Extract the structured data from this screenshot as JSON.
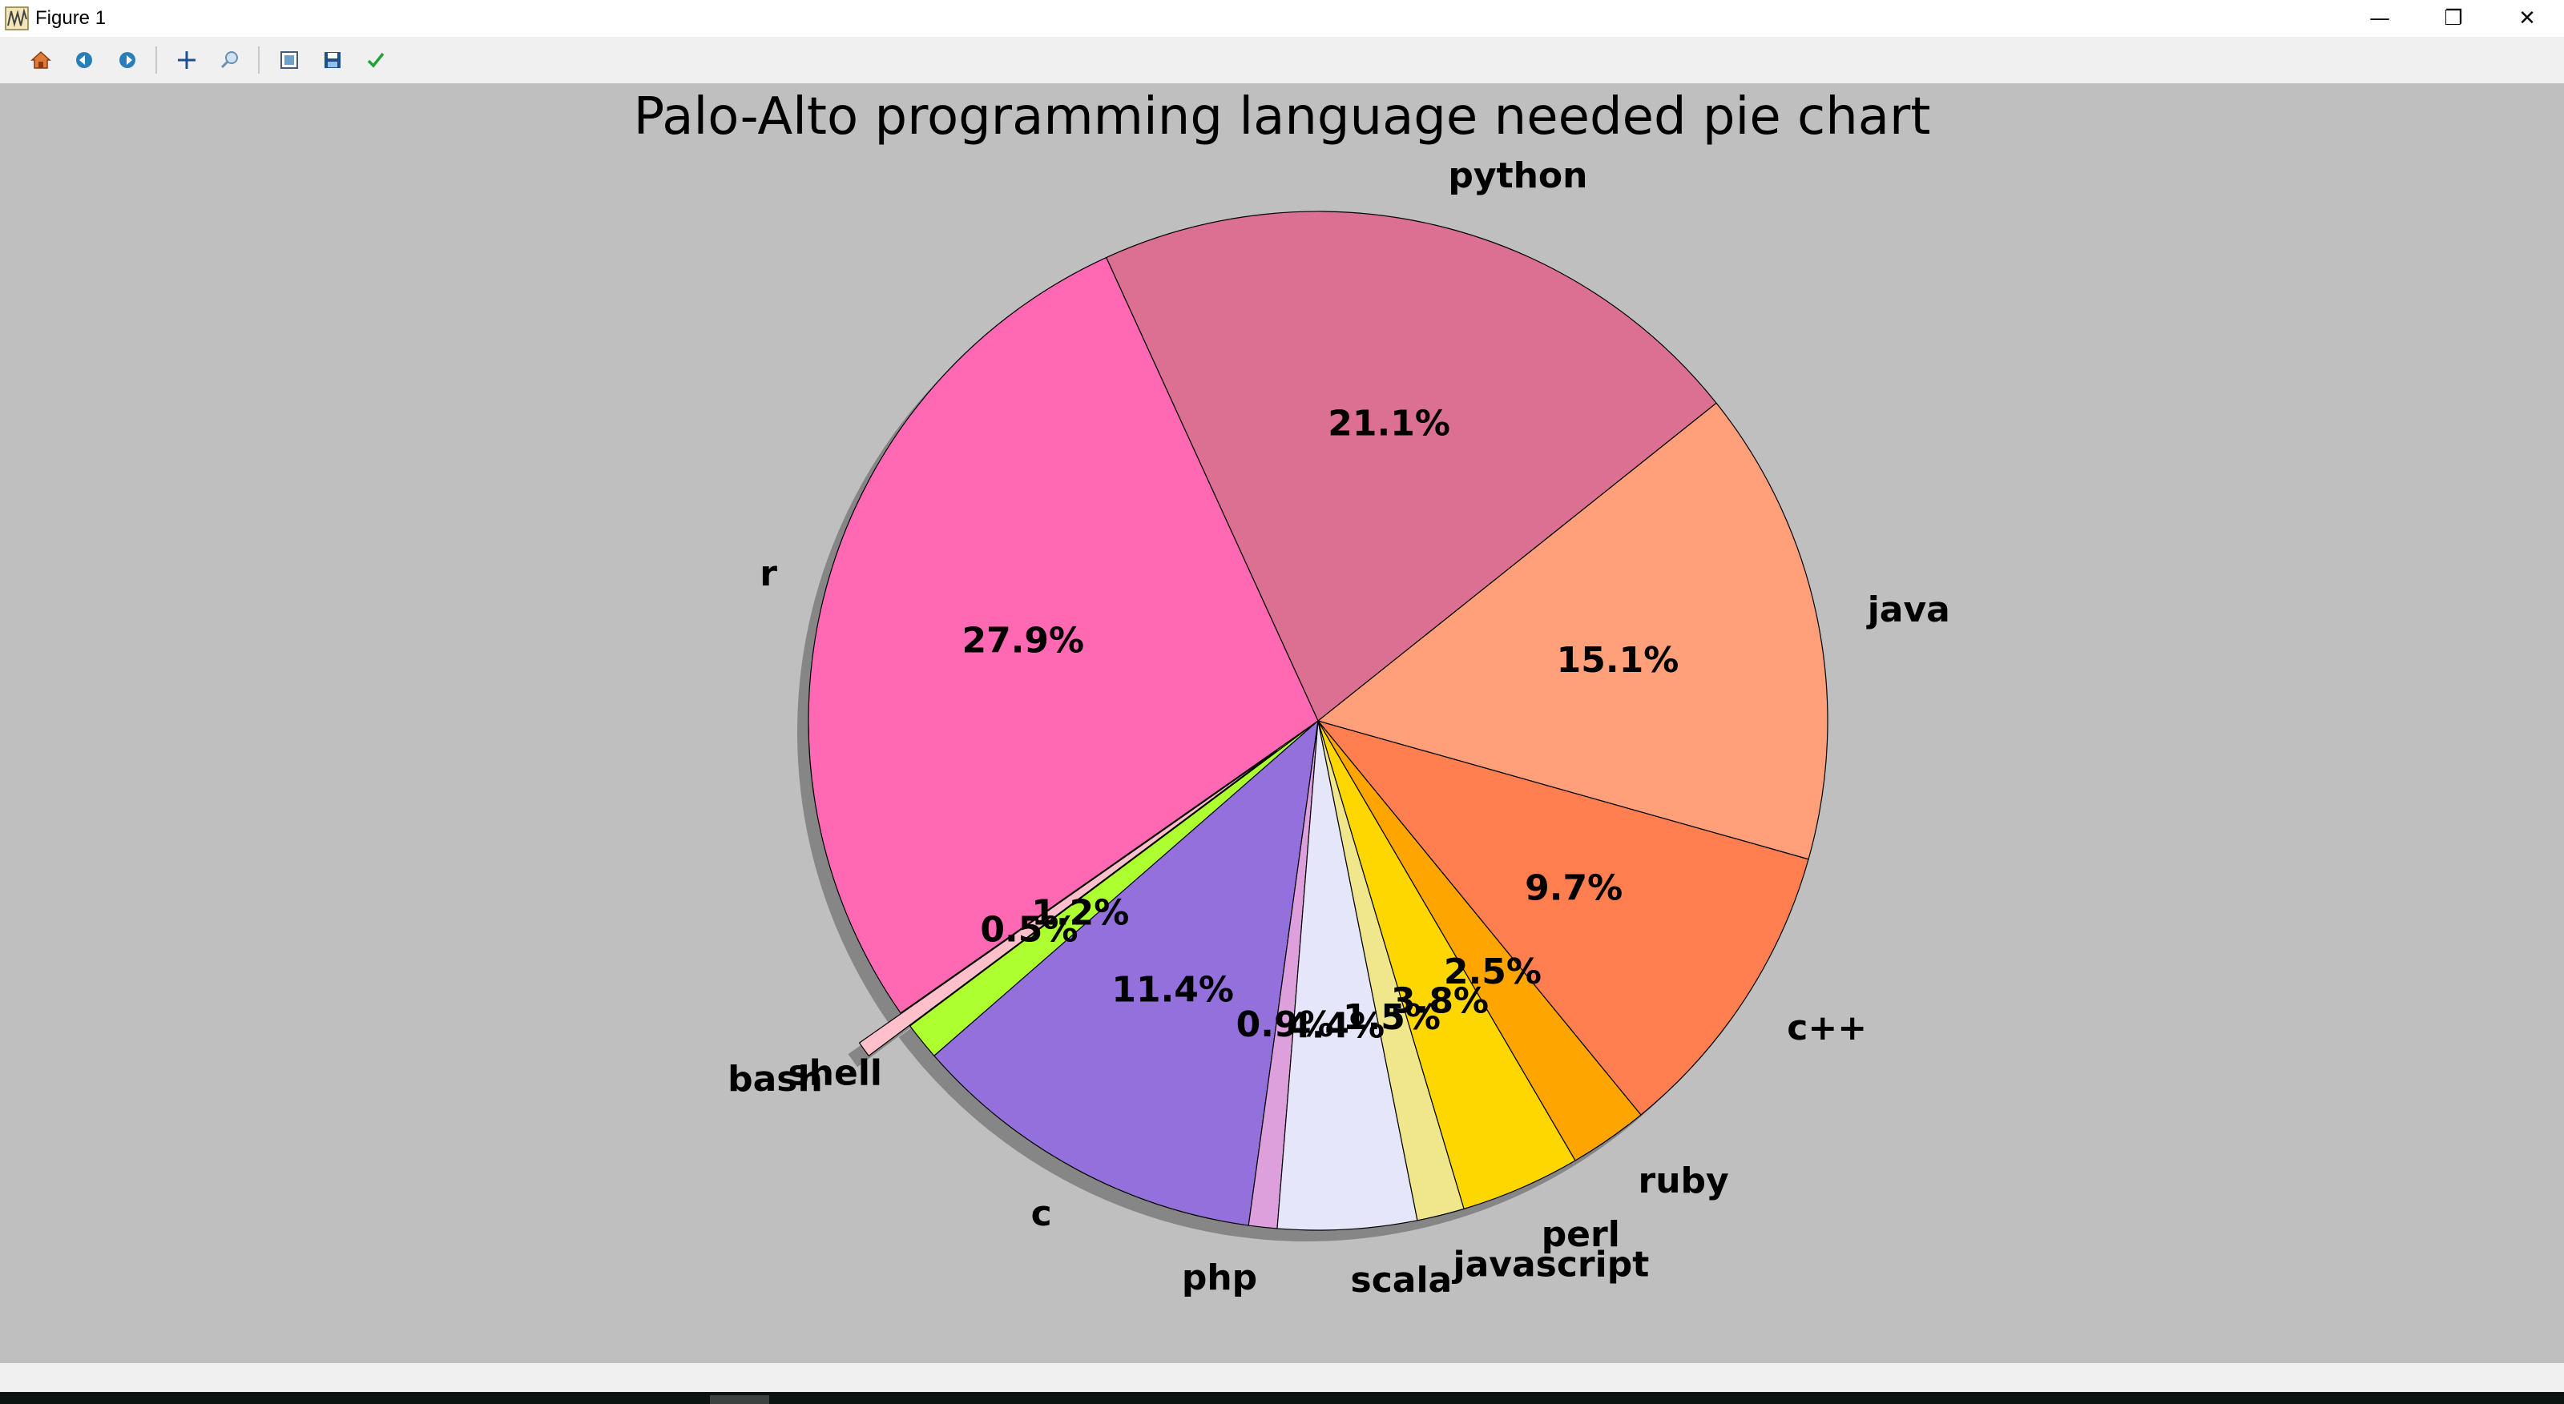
{
  "window": {
    "title": "Figure 1",
    "minimize_glyph": "—",
    "restore_glyph": "❐",
    "close_glyph": "✕"
  },
  "toolbar": {
    "buttons": [
      {
        "icon": "home-icon"
      },
      {
        "icon": "back-arrow-icon"
      },
      {
        "icon": "forward-arrow-icon"
      },
      {
        "icon": "pan-icon"
      },
      {
        "icon": "zoom-icon"
      },
      {
        "icon": "configure-subplots-icon"
      },
      {
        "icon": "save-icon"
      },
      {
        "icon": "edit-parameters-icon"
      }
    ]
  },
  "chart_data": {
    "type": "pie",
    "title": "Palo-Alto programming language needed pie chart",
    "start_angle_deg": -145,
    "direction": "counterclockwise",
    "shadow": true,
    "slices": [
      {
        "label": "bash",
        "value": 0.5,
        "pct": "0.5%",
        "color": "#ffc0cb",
        "explode": true
      },
      {
        "label": "shell",
        "value": 1.2,
        "pct": "1.2%",
        "color": "#adff2f",
        "explode": false
      },
      {
        "label": "c",
        "value": 11.4,
        "pct": "11.4%",
        "color": "#9370db",
        "explode": false
      },
      {
        "label": "php",
        "value": 0.9,
        "pct": "0.9%",
        "color": "#dda0dd",
        "explode": false
      },
      {
        "label": "scala",
        "value": 4.4,
        "pct": "4.4%",
        "color": "#e6e6fa",
        "explode": false
      },
      {
        "label": "javascript",
        "value": 1.5,
        "pct": "1.5%",
        "color": "#f0e68c",
        "explode": false
      },
      {
        "label": "perl",
        "value": 3.8,
        "pct": "3.8%",
        "color": "#ffd700",
        "explode": false
      },
      {
        "label": "ruby",
        "value": 2.5,
        "pct": "2.5%",
        "color": "#ffa500",
        "explode": false
      },
      {
        "label": "c++",
        "value": 9.7,
        "pct": "9.7%",
        "color": "#ff7f50",
        "explode": false
      },
      {
        "label": "java",
        "value": 15.1,
        "pct": "15.1%",
        "color": "#ffa07a",
        "explode": false
      },
      {
        "label": "python",
        "value": 21.1,
        "pct": "21.1%",
        "color": "#db7093",
        "explode": false
      },
      {
        "label": "r",
        "value": 27.9,
        "pct": "27.9%",
        "color": "#ff69b4",
        "explode": false
      }
    ]
  }
}
